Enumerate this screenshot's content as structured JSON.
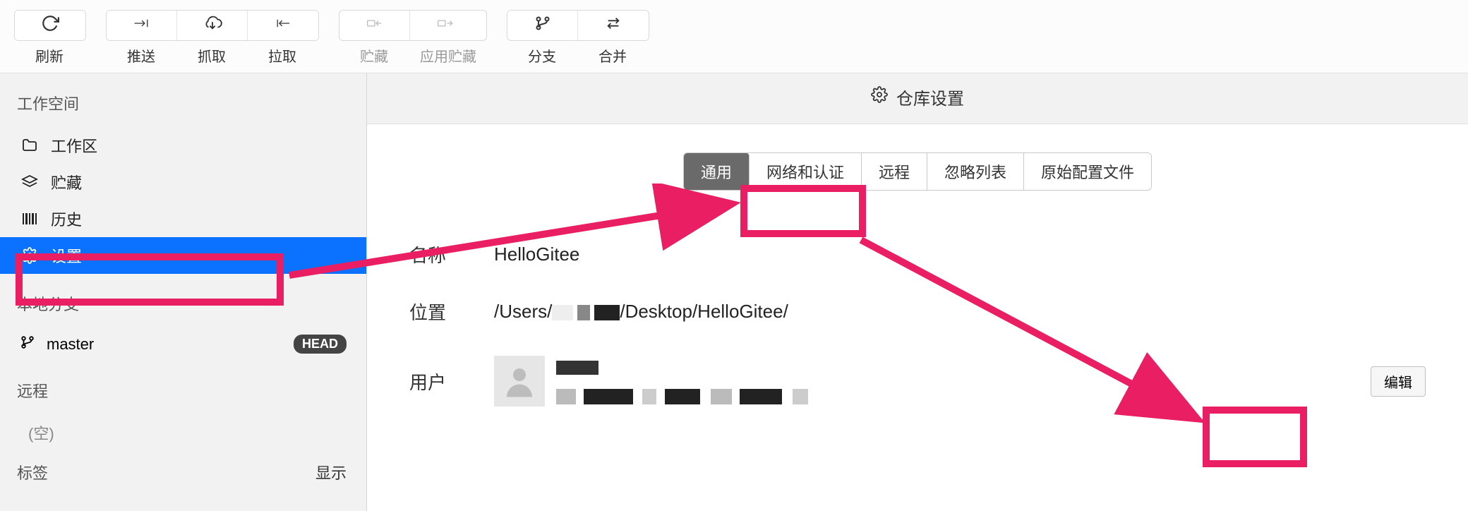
{
  "toolbar": {
    "groups": [
      {
        "items": [
          {
            "icon": "refresh",
            "label": "刷新",
            "disabled": false
          }
        ]
      },
      {
        "items": [
          {
            "icon": "push",
            "label": "推送",
            "disabled": false
          },
          {
            "icon": "fetch",
            "label": "抓取",
            "disabled": false
          },
          {
            "icon": "pull",
            "label": "拉取",
            "disabled": false
          }
        ]
      },
      {
        "items": [
          {
            "icon": "stash",
            "label": "贮藏",
            "disabled": true
          },
          {
            "icon": "unstash",
            "label": "应用贮藏",
            "disabled": true
          }
        ]
      },
      {
        "items": [
          {
            "icon": "branch",
            "label": "分支",
            "disabled": false
          },
          {
            "icon": "merge",
            "label": "合并",
            "disabled": false
          }
        ]
      }
    ]
  },
  "sidebar": {
    "workspace_header": "工作空间",
    "items": [
      {
        "icon": "folder",
        "label": "工作区"
      },
      {
        "icon": "stack",
        "label": "贮藏"
      },
      {
        "icon": "history",
        "label": "历史"
      },
      {
        "icon": "gear",
        "label": "设置",
        "selected": true
      }
    ],
    "local_branches_header": "本地分支",
    "branch": {
      "name": "master",
      "badge": "HEAD"
    },
    "remote_header": "远程",
    "remote_empty": "(空)",
    "tags_header": "标签",
    "tags_action": "显示"
  },
  "content": {
    "header_title": "仓库设置",
    "tabs": [
      {
        "label": "通用",
        "active": true
      },
      {
        "label": "网络和认证"
      },
      {
        "label": "远程"
      },
      {
        "label": "忽略列表"
      },
      {
        "label": "原始配置文件"
      }
    ],
    "rows": {
      "name_label": "名称",
      "name_value": "HelloGitee",
      "location_label": "位置",
      "location_prefix": "/Users/",
      "location_suffix": "/Desktop/HelloGitee/",
      "user_label": "用户",
      "edit_label": "编辑"
    }
  }
}
